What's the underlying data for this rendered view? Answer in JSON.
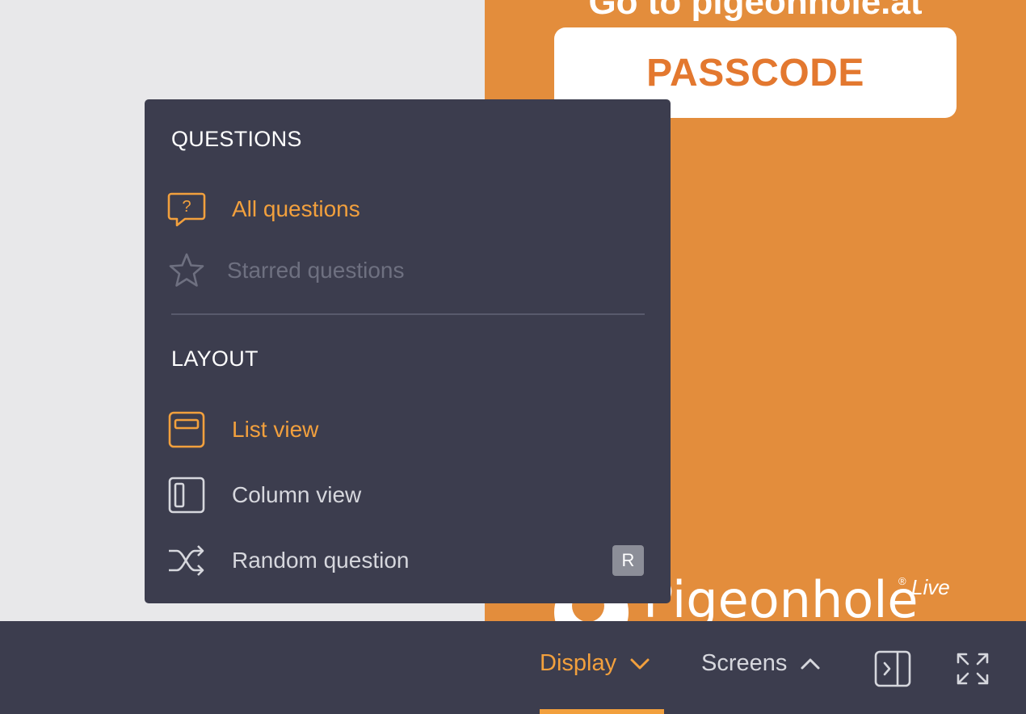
{
  "background": {
    "heading": "Go to pigeonhole.at",
    "passcode": "PASSCODE",
    "brand_name": "Pigeonhole",
    "brand_reg": "®",
    "brand_live": "Live",
    "accent_color": "#e38d3c"
  },
  "menu": {
    "questions_title": "QUESTIONS",
    "questions_items": [
      {
        "label": "All questions",
        "icon": "question-bubble-icon",
        "state": "active"
      },
      {
        "label": "Starred questions",
        "icon": "star-icon",
        "state": "disabled"
      }
    ],
    "layout_title": "LAYOUT",
    "layout_items": [
      {
        "label": "List view",
        "icon": "list-view-icon",
        "state": "active"
      },
      {
        "label": "Column view",
        "icon": "column-view-icon",
        "state": "normal"
      },
      {
        "label": "Random question",
        "icon": "shuffle-icon",
        "state": "normal",
        "shortcut": "R"
      }
    ]
  },
  "bottom_bar": {
    "display_label": "Display",
    "screens_label": "Screens",
    "sidebar_toggle_icon": "sidebar-toggle-icon",
    "fullscreen_icon": "fullscreen-icon",
    "active_color": "#f2a03d"
  }
}
